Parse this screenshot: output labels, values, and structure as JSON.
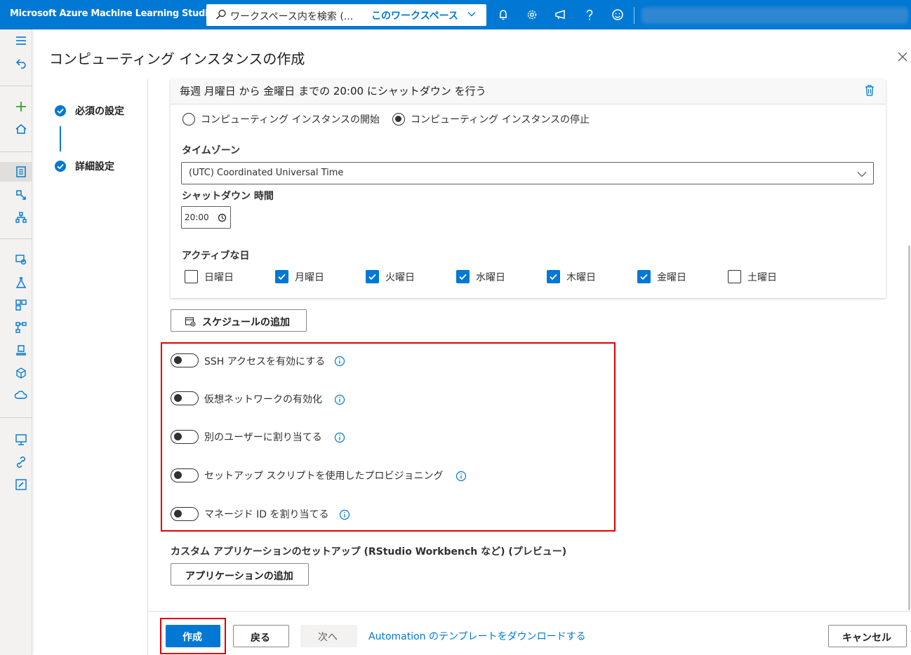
{
  "header": {
    "app_title": "Microsoft Azure Machine Learning Studio",
    "search_placeholder": "ワークスペース内を検索 (...",
    "search_scope": "このワークスペース",
    "icons": [
      "bell-icon",
      "gear-icon",
      "megaphone-icon",
      "help-icon",
      "smiley-icon"
    ]
  },
  "colors": {
    "accent": "#0078d4",
    "highlight": "#e00000"
  },
  "panel": {
    "title": "コンピューティング インスタンスの作成",
    "steps": [
      {
        "label": "必須の設定"
      },
      {
        "label": "詳細設定"
      }
    ]
  },
  "schedule": {
    "summary": "毎週 月曜日 から 金曜日 までの 20:00 にシャットダウン を行う",
    "action_options": [
      {
        "label": "コンピューティング インスタンスの開始",
        "selected": false
      },
      {
        "label": "コンピューティング インスタンスの停止",
        "selected": true
      }
    ],
    "timezone_label": "タイムゾーン",
    "timezone_value": "(UTC) Coordinated Universal Time",
    "time_label": "シャットダウン 時間",
    "time_value": "20:00",
    "days_label": "アクティブな日",
    "days": [
      {
        "label": "日曜日",
        "checked": false
      },
      {
        "label": "月曜日",
        "checked": true
      },
      {
        "label": "火曜日",
        "checked": true
      },
      {
        "label": "水曜日",
        "checked": true
      },
      {
        "label": "木曜日",
        "checked": true
      },
      {
        "label": "金曜日",
        "checked": true
      },
      {
        "label": "土曜日",
        "checked": false
      }
    ]
  },
  "add_schedule_label": "スケジュールの追加",
  "toggles": [
    {
      "label": "SSH アクセスを有効にする",
      "on": false
    },
    {
      "label": "仮想ネットワークの有効化",
      "on": false
    },
    {
      "label": "別のユーザーに割り当てる",
      "on": false
    },
    {
      "label": "セットアップ スクリプトを使用したプロビジョニング",
      "on": false
    },
    {
      "label": "マネージド ID を割り当てる",
      "on": false
    }
  ],
  "custom_apps": {
    "label": "カスタム アプリケーションのセットアップ (RStudio Workbench など) (プレビュー)",
    "add_label": "アプリケーションの追加"
  },
  "footer": {
    "create": "作成",
    "back": "戻る",
    "next": "次へ",
    "download_link": "Automation のテンプレートをダウンロードする",
    "cancel": "キャンセル"
  }
}
